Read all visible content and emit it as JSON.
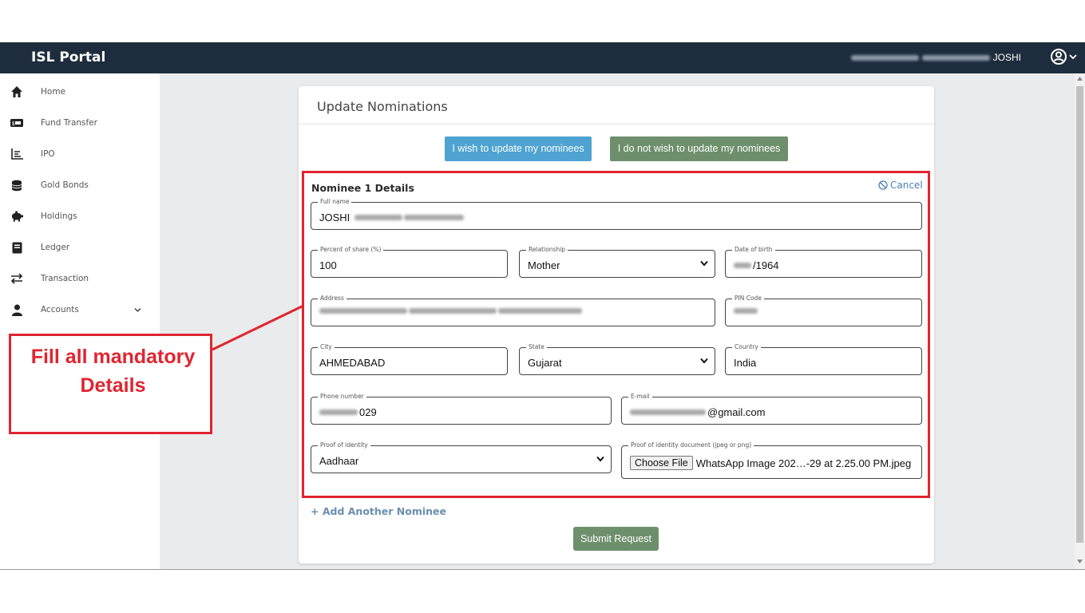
{
  "app": {
    "title": "ISL Portal",
    "user_suffix": "JOSHI"
  },
  "sidebar": {
    "items": [
      {
        "label": "Home",
        "icon": "home-icon"
      },
      {
        "label": "Fund Transfer",
        "icon": "money-icon"
      },
      {
        "label": "IPO",
        "icon": "chart-icon"
      },
      {
        "label": "Gold Bonds",
        "icon": "coins-icon"
      },
      {
        "label": "Holdings",
        "icon": "piggy-bank-icon"
      },
      {
        "label": "Ledger",
        "icon": "book-icon"
      },
      {
        "label": "Transaction",
        "icon": "exchange-icon"
      },
      {
        "label": "Accounts",
        "icon": "user-icon"
      }
    ]
  },
  "card": {
    "title": "Update Nominations",
    "update_button": "I wish to update my nominees",
    "no_update_button": "I do not wish to update my nominees"
  },
  "nominee": {
    "title": "Nominee 1 Details",
    "cancel": "Cancel",
    "full_name": {
      "label": "Full name",
      "value": "JOSHI"
    },
    "percent": {
      "label": "Percent of share (%)",
      "value": "100"
    },
    "relationship": {
      "label": "Relationship",
      "value": "Mother"
    },
    "dob": {
      "label": "Date of birth",
      "value": "/1964"
    },
    "address": {
      "label": "Address"
    },
    "pin": {
      "label": "PIN Code"
    },
    "city": {
      "label": "City",
      "value": "AHMEDABAD"
    },
    "state": {
      "label": "State",
      "value": "Gujarat"
    },
    "country": {
      "label": "Country",
      "value": "India"
    },
    "phone": {
      "label": "Phone number",
      "value": "029"
    },
    "email": {
      "label": "E-mail",
      "value": "@gmail.com"
    },
    "proof": {
      "label": "Proof of identity",
      "value": "Aadhaar"
    },
    "proof_doc": {
      "label": "Proof of identity document (jpeg or png)",
      "button": "Choose File",
      "file": "WhatsApp Image 202…-29 at 2.25.00 PM.jpeg"
    }
  },
  "actions": {
    "add_nominee": "+ Add Another Nominee",
    "submit": "Submit Request"
  },
  "annotation": {
    "line1": "Fill all mandatory",
    "line2": "Details",
    "color": "#e02530"
  },
  "colors": {
    "topbar": "#1e2d3d",
    "blue_button": "#4fa3d1",
    "green_button": "#6e8f6c",
    "link": "#4a7fb5"
  }
}
